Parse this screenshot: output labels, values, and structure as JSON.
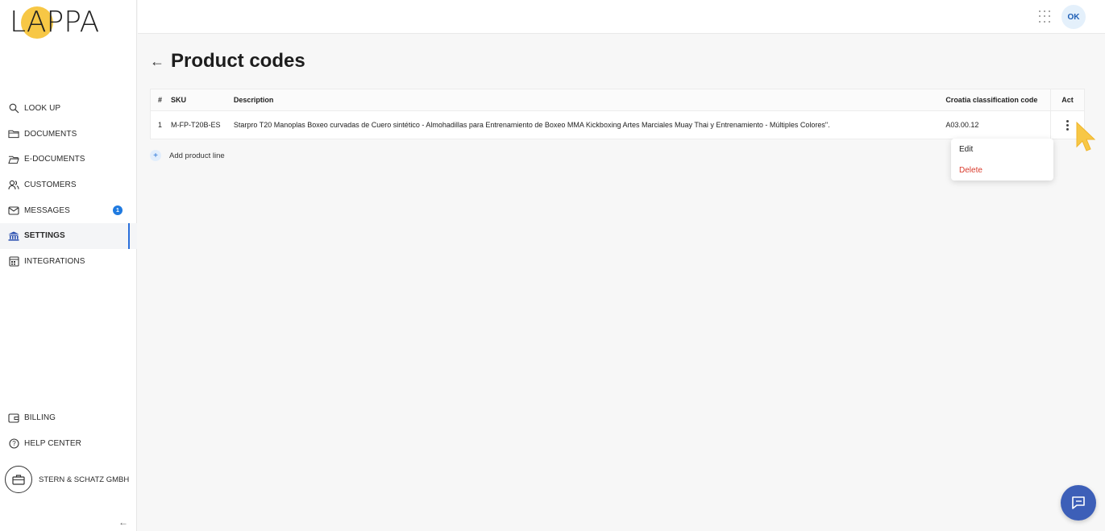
{
  "logo": {
    "text": "LAPPA"
  },
  "sidebar": {
    "items": [
      {
        "label": "LOOK UP",
        "icon": "search-icon"
      },
      {
        "label": "DOCUMENTS",
        "icon": "folder-icon"
      },
      {
        "label": "E-DOCUMENTS",
        "icon": "folder-open-icon"
      },
      {
        "label": "CUSTOMERS",
        "icon": "users-icon"
      },
      {
        "label": "MESSAGES",
        "icon": "mail-icon",
        "badge": "1"
      },
      {
        "label": "SETTINGS",
        "icon": "bank-icon",
        "active": true
      },
      {
        "label": "INTEGRATIONS",
        "icon": "calendar-grid-icon"
      }
    ],
    "bottom": [
      {
        "label": "BILLING",
        "icon": "wallet-icon"
      },
      {
        "label": "HELP CENTER",
        "icon": "help-icon"
      }
    ],
    "company": "STERN & SCHATZ GMBH"
  },
  "header": {
    "avatar_initials": "OK"
  },
  "page": {
    "title": "Product codes"
  },
  "table": {
    "headers": {
      "num": "#",
      "sku": "SKU",
      "description": "Description",
      "code": "Croatia classification code",
      "act": "Act"
    },
    "rows": [
      {
        "num": "1",
        "sku": "M-FP-T20B-ES",
        "description": "Starpro T20 Manoplas Boxeo curvadas de Cuero sintético - Almohadillas para Entrenamiento de Boxeo MMA Kickboxing Artes Marciales Muay Thai y Entrenamiento - Múltiples Colores\".",
        "code": "A03.00.12"
      }
    ]
  },
  "add_line": {
    "label": "Add product line"
  },
  "menu": {
    "edit": "Edit",
    "delete": "Delete"
  },
  "colors": {
    "accent": "#2a6fdb",
    "logo_sun": "#f7c745",
    "delete": "#d93a2b",
    "chat": "#3d5fb8"
  }
}
